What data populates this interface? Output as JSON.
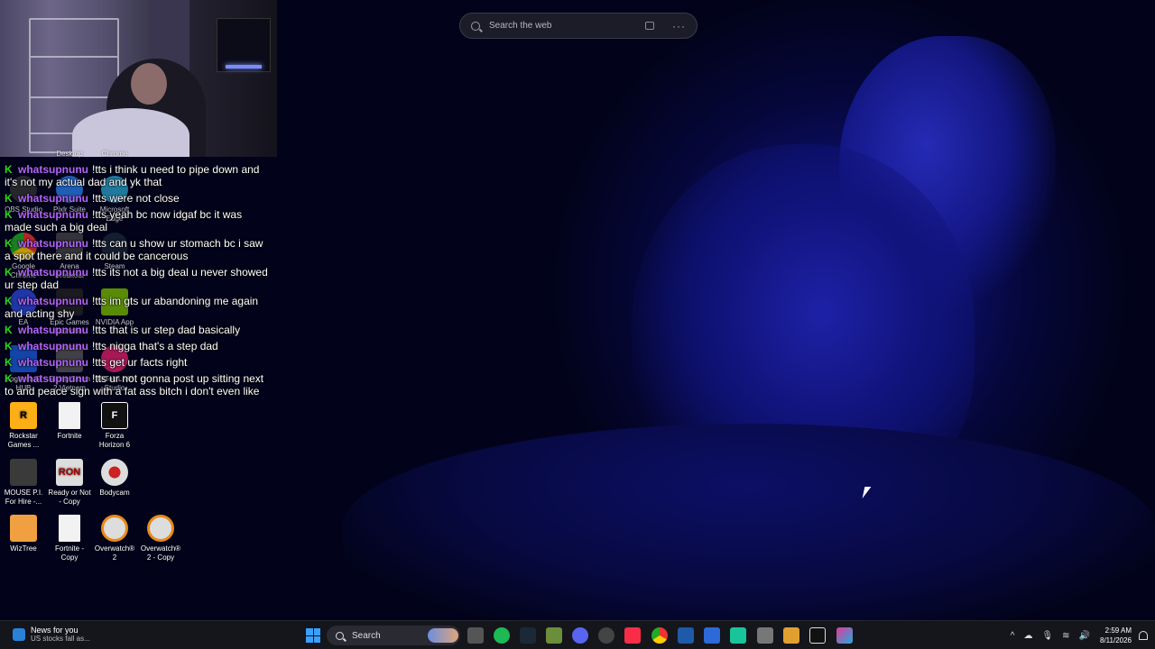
{
  "search_widget": {
    "placeholder": "Search the web"
  },
  "chat": [
    {
      "user": "whatsupnunu",
      "text": "!tts i think u need to pipe down and it's not my actual dad and yk that"
    },
    {
      "user": "whatsupnunu",
      "text": "!tts were not close"
    },
    {
      "user": "whatsupnunu",
      "text": "!tts yeah bc now idgaf bc it was made such a big deal"
    },
    {
      "user": "whatsupnunu",
      "text": "!tts can u show ur stomach bc i saw a spot there and it could be cancerous"
    },
    {
      "user": "whatsupnunu",
      "text": "!tts its not a big deal u never showed ur step dad"
    },
    {
      "user": "whatsupnunu",
      "text": "!tts im gts ur abandoning me again and acting shy"
    },
    {
      "user": "whatsupnunu",
      "text": "!tts that is ur step dad basically"
    },
    {
      "user": "whatsupnunu",
      "text": "!tts nigga that's a step dad"
    },
    {
      "user": "whatsupnunu",
      "text": "!tts get ur facts right"
    },
    {
      "user": "whatsupnunu",
      "text": "!tts ur not gonna post up sitting next to and peace sign with a fat ass bitch i don't even like"
    }
  ],
  "desktop_icons": {
    "desktop": "Desktop",
    "chrome": "Chrome",
    "obs": "OBS Studio",
    "pixlr": "Pixlr Suite",
    "edge": "Microsoft Edge",
    "google": "Google Chrome",
    "arena": "Arena Breakout",
    "steam": "Steam",
    "ea": "EA",
    "epic": "Epic Games Launcher",
    "nvidia": "NVIDIA App",
    "logitech": "Logitech G HUB",
    "rising_storm": "Rising Storm 2 Vietnam",
    "tiktok": "TikTok LIVE Studio",
    "rockstar": "Rockstar Games ...",
    "fortnite": "Fortnite",
    "forza": "Forza Horizon 6",
    "mouse": "MOUSE P.I. For Hire -...",
    "ready_or_not": "Ready or Not - Copy",
    "bodycam": "Bodycam",
    "wiztree": "WizTree",
    "fortnite_copy": "Fortnite - Copy",
    "overwatch2": "Overwatch® 2",
    "overwatch2_copy": "Overwatch® 2 - Copy"
  },
  "taskbar": {
    "news_title": "News for you",
    "news_sub": "US stocks fall as...",
    "search_label": "Search",
    "time": "2:59 AM",
    "date": "8/11/2026"
  },
  "colors": {
    "chat_user": "#b563ff",
    "chat_badge": "#2dd41f",
    "windows_accent": "#3aa0ff"
  }
}
